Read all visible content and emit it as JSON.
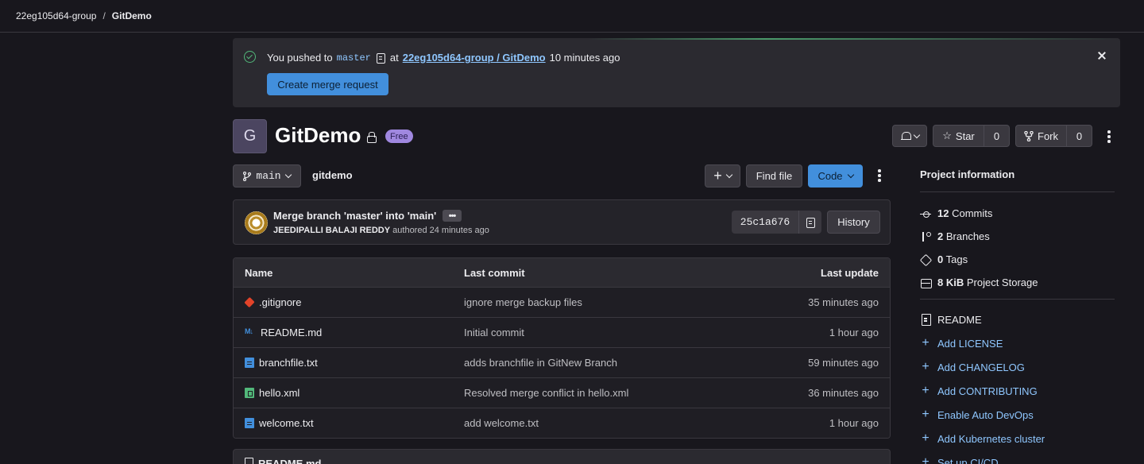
{
  "breadcrumb": {
    "group": "22eg105d64-group",
    "separator": "/",
    "project": "GitDemo"
  },
  "alert": {
    "prefix": "You pushed to",
    "branch": "master",
    "at": "at",
    "target": "22eg105d64-group / GitDemo",
    "time": "10 minutes ago",
    "button": "Create merge request"
  },
  "project": {
    "avatar_letter": "G",
    "name": "GitDemo",
    "badge": "Free",
    "star_label": "Star",
    "star_count": "0",
    "fork_label": "Fork",
    "fork_count": "0"
  },
  "toolbar": {
    "branch": "main",
    "path": "gitdemo",
    "plus": "+",
    "find_file": "Find file",
    "code": "Code"
  },
  "commit": {
    "title": "Merge branch 'master' into 'main'",
    "dots": "•••",
    "author": "JEEDIPALLI BALAJI REDDY",
    "authored": "authored 24 minutes ago",
    "sha": "25c1a676",
    "history": "History"
  },
  "files": {
    "headers": {
      "name": "Name",
      "last_commit": "Last commit",
      "last_update": "Last update"
    },
    "rows": [
      {
        "name": ".gitignore",
        "commit": "ignore merge backup files",
        "updated": "35 minutes ago",
        "icon": "git-file-icon"
      },
      {
        "name": "README.md",
        "commit": "Initial commit",
        "updated": "1 hour ago",
        "icon": "markdown-icon"
      },
      {
        "name": "branchfile.txt",
        "commit": "adds branchfile in GitNew Branch",
        "updated": "59 minutes ago",
        "icon": "text-file-icon"
      },
      {
        "name": "hello.xml",
        "commit": "Resolved merge conflict in hello.xml",
        "updated": "36 minutes ago",
        "icon": "xml-file-icon"
      },
      {
        "name": "welcome.txt",
        "commit": "add welcome.txt",
        "updated": "1 hour ago",
        "icon": "text-file-icon"
      }
    ]
  },
  "readme_box": {
    "title": "README.md"
  },
  "sidebar": {
    "title": "Project information",
    "commits_count": "12",
    "commits_label": "Commits",
    "branches_count": "2",
    "branches_label": "Branches",
    "tags_count": "0",
    "tags_label": "Tags",
    "storage_size": "8 KiB",
    "storage_label": "Project Storage",
    "readme": "README",
    "links": [
      "Add LICENSE",
      "Add CHANGELOG",
      "Add CONTRIBUTING",
      "Enable Auto DevOps",
      "Add Kubernetes cluster",
      "Set up CI/CD"
    ]
  },
  "colors": {
    "accent_blue": "#428fdc",
    "success": "#52b87a",
    "badge_purple": "#a088e0",
    "background": "#18171d"
  }
}
